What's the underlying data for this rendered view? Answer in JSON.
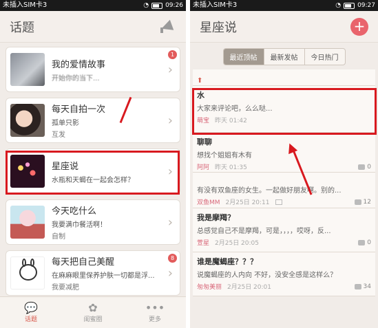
{
  "left": {
    "status": {
      "carrier": "未插入SIM卡3",
      "time": "09:26"
    },
    "header": {
      "title": "话题"
    },
    "topics": [
      {
        "title": "我的爱情故事",
        "desc": "开始你的当下...",
        "desc2": "",
        "badge": "1"
      },
      {
        "title": "每天自拍一次",
        "desc": "孤单只影",
        "desc2": "互发",
        "badge": ""
      },
      {
        "title": "星座说",
        "desc": "水瓶和天蝎在一起会怎样？",
        "desc2": "",
        "badge": ""
      },
      {
        "title": "今天吃什么",
        "desc": "我要满巾餐活啊！",
        "desc2": "自制",
        "badge": ""
      },
      {
        "title": "每天把自己美醒",
        "desc": "在麻麻眼里保养护肤一切都是浮...",
        "desc2": "我要减肥",
        "badge": "8"
      }
    ],
    "nav": [
      {
        "label": "话题",
        "icon": "chat-bubbles-icon",
        "glyph": "💬"
      },
      {
        "label": "闺蜜圈",
        "icon": "flower-icon",
        "glyph": "✿"
      },
      {
        "label": "更多",
        "icon": "more-dots-icon",
        "glyph": "•••"
      }
    ]
  },
  "right": {
    "status": {
      "carrier": "未插入SIM卡3",
      "time": "09:27"
    },
    "header": {
      "title": "星座说",
      "add_label": "+"
    },
    "tabs": [
      "最近顶帖",
      "最新发帖",
      "今日热门"
    ],
    "posts": [
      {
        "title": "",
        "body": "",
        "author": "",
        "date": "",
        "count": ""
      },
      {
        "title": "水",
        "body": "大家来评论吧，么么哒...",
        "author": "萌宝",
        "date": "昨天 01:42",
        "count": ""
      },
      {
        "title": "聊聊",
        "body": "想找个姐姐有木有",
        "author": "阿阿",
        "date": "昨天 01:35",
        "count": "0"
      },
      {
        "title": "",
        "body": "有没有双鱼座的女生。一起做好朋友啊。别的...",
        "author": "双鱼MM",
        "date": "2月25日 20:11",
        "count": "12"
      },
      {
        "title": "我是摩羯？",
        "body": "总感觉自己不是摩羯，可是，，，，哎呀，反...",
        "author": "萱星",
        "date": "2月25日 20:05",
        "count": "0"
      },
      {
        "title": "谁是魔蝎座？？？",
        "body": "说魔蝎座的人内向  不好，没安全感是这样么？",
        "author": "匆匆美丽",
        "date": "2月25日 20:01",
        "count": "34"
      }
    ]
  },
  "colors": {
    "accent_red": "#d8191f",
    "plus_pink": "#e9646c",
    "nav_active": "#d85a4e"
  }
}
